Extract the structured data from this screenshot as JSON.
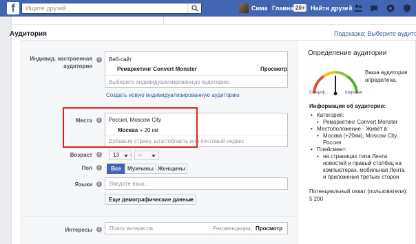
{
  "topbar": {
    "logo": "f",
    "search_placeholder": "Ищите друзей",
    "user_name": "Сима",
    "home_label": "Главная",
    "home_badge": "20+",
    "find_friends_label": "Найти друзей",
    "icons": [
      "friend-requests-icon",
      "messages-icon",
      "notifications-icon",
      "privacy-icon"
    ]
  },
  "section": {
    "title": "Аудитория",
    "hint_link": "Подсказка: Выберите аудиторию"
  },
  "custom_audience": {
    "label": "Индивид. настроенная аудитория",
    "type": "Веб-сайт",
    "selected_name": "Ремаркетинг Convert Monster",
    "view_label": "Просмотр",
    "input_placeholder": "Выберите индивидуализированную аудиторию",
    "create_link": "Создать новую индивидуализированную аудиторию"
  },
  "places": {
    "label": "Места",
    "location": "Россия, Moscow City",
    "city": "Москва",
    "radius": "+ 20 км",
    "input_placeholder": "Добавьте страну, штат/область или почтовый индекс"
  },
  "age": {
    "label": "Возраст",
    "from": "13",
    "dash": "-",
    "to": "--"
  },
  "gender": {
    "label": "Пол",
    "options": [
      "Все",
      "Мужчины",
      "Женщины"
    ],
    "selected": "Все"
  },
  "languages": {
    "label": "Языки",
    "placeholder": "Введите язык..."
  },
  "more_demographics": {
    "label": "Еще демографические данные"
  },
  "interests": {
    "label": "Интересы",
    "placeholder": "Поиск интересов",
    "suggestions_label": "Рекомендации",
    "view_label": "Просмотр"
  },
  "audience_definition": {
    "title": "Определение аудитории",
    "gauge_left": "Специф...",
    "gauge_right": "Широкая",
    "status": "Ваша аудитория определена.",
    "info_title": "Информация об аудитории:",
    "category_label": "Категория:",
    "category_value": "Ремаркетинг Convert Monster",
    "location_label": "Местоположение - Живёт в:",
    "location_value": "Москва (+20км), Moscow City, Россия",
    "placement_label": "Плейсмент:",
    "placement_value": "на страницах типа Лента новостей и правый столбец на компьютерах, мобильная Лента и приложения третьих сторон",
    "reach_label": "Потенциальный охват (пользователи):",
    "reach_value": "5 200"
  },
  "colors": {
    "brand": "#4267b2",
    "link": "#365899",
    "highlight": "#e02020"
  }
}
